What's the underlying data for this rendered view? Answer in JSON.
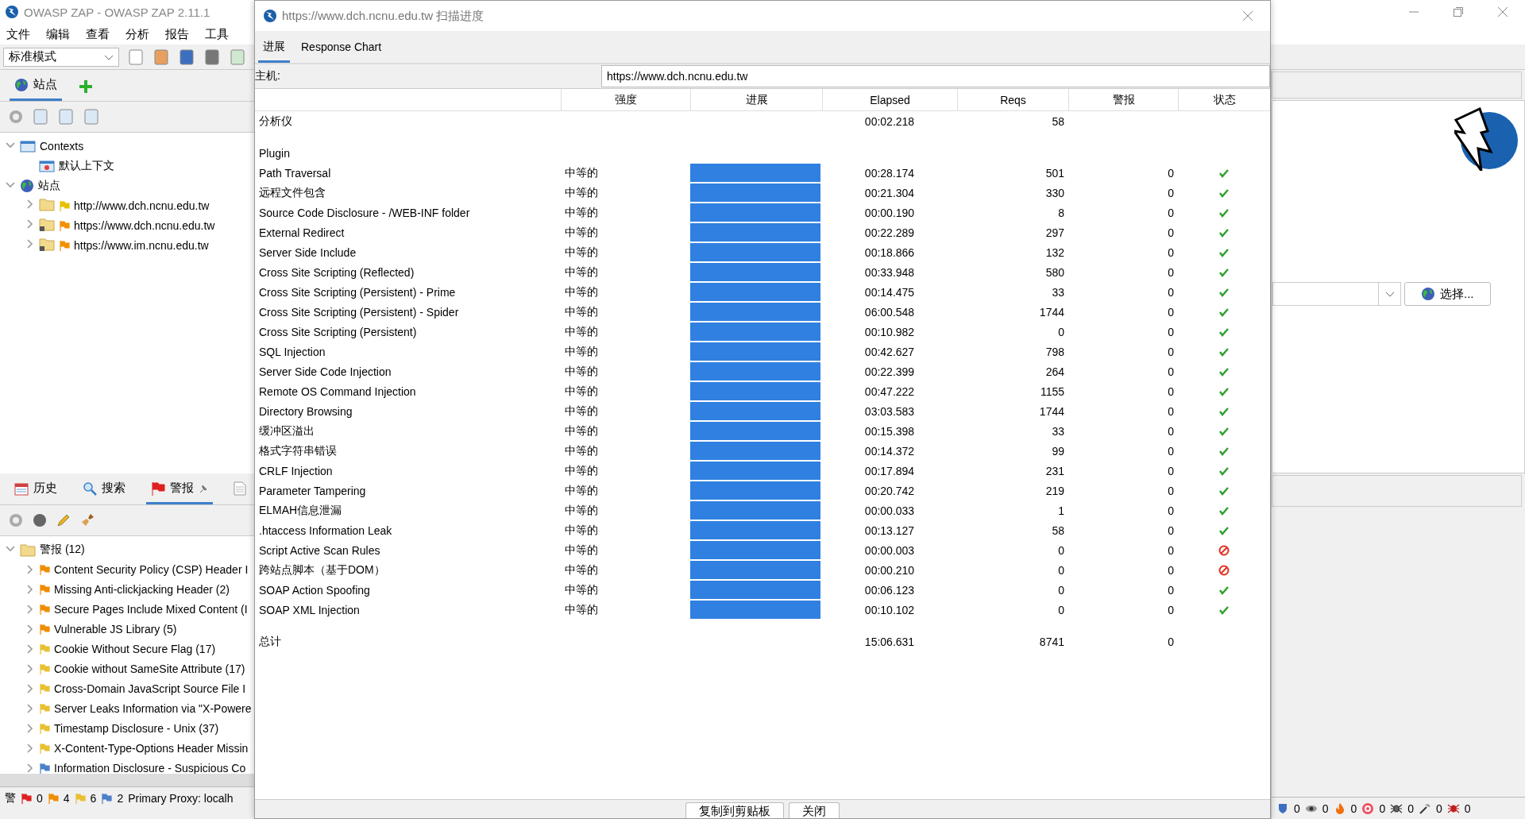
{
  "main_window": {
    "title": "OWASP ZAP - OWASP ZAP 2.11.1",
    "menu": [
      "文件",
      "编辑",
      "查看",
      "分析",
      "报告",
      "工具"
    ],
    "mode_select": {
      "value": "标准模式"
    },
    "sites_tab": {
      "label": "站点",
      "selected": true
    },
    "tree": [
      {
        "label": "Contexts",
        "kind": "contexts",
        "expanded": true,
        "children": [
          {
            "label": "默认上下文",
            "kind": "context"
          }
        ]
      },
      {
        "label": "站点",
        "kind": "sites",
        "expanded": true,
        "children": [
          {
            "label": "http://www.dch.ncnu.edu.tw",
            "kind": "site",
            "expanded": false,
            "color": "#e8c000",
            "locked": false
          },
          {
            "label": "https://www.dch.ncnu.edu.tw",
            "kind": "site",
            "expanded": false,
            "color": "#f09000",
            "locked": true
          },
          {
            "label": "https://www.im.ncnu.edu.tw",
            "kind": "site",
            "expanded": false,
            "color": "#f09000",
            "locked": true
          }
        ]
      }
    ],
    "bottom_tabs": [
      {
        "label": "历史",
        "kind": "history",
        "selected": false
      },
      {
        "label": "搜索",
        "kind": "search",
        "selected": false
      },
      {
        "label": "警报",
        "kind": "alerts",
        "selected": true
      },
      {
        "kind": "output",
        "selected": false
      }
    ],
    "alert_root": {
      "label": "警报 (12)",
      "expanded": true
    },
    "alerts": [
      {
        "label": "Content Security Policy (CSP) Header I",
        "color": "#f08c00"
      },
      {
        "label": "Missing Anti-clickjacking Header (2)",
        "color": "#f08c00"
      },
      {
        "label": "Secure Pages Include Mixed Content (I",
        "color": "#f08c00"
      },
      {
        "label": "Vulnerable JS Library (5)",
        "color": "#f08c00"
      },
      {
        "label": "Cookie Without Secure Flag (17)",
        "color": "#e8c030"
      },
      {
        "label": "Cookie without SameSite Attribute (17)",
        "color": "#e8c030"
      },
      {
        "label": "Cross-Domain JavaScript Source File I",
        "color": "#e8c030"
      },
      {
        "label": "Server Leaks Information via \"X-Powere",
        "color": "#e8c030"
      },
      {
        "label": "Timestamp Disclosure - Unix (37)",
        "color": "#e8c030"
      },
      {
        "label": "X-Content-Type-Options Header Missin",
        "color": "#e8c030"
      },
      {
        "label": "Information Disclosure - Suspicious Co",
        "color": "#4a80c8"
      }
    ],
    "status_bar": {
      "label": "警",
      "counts": [
        {
          "value": "0",
          "color": "#e02020"
        },
        {
          "value": "4",
          "color": "#f08c00"
        },
        {
          "value": "6",
          "color": "#e8c030"
        },
        {
          "value": "2",
          "color": "#4a80c8"
        }
      ],
      "proxy": "Primary Proxy: localh"
    },
    "url_select": {
      "button": "选择..."
    },
    "scan_counts": [
      {
        "kind": "shield",
        "value": "0"
      },
      {
        "kind": "eye",
        "value": "0"
      },
      {
        "kind": "flame",
        "value": "0"
      },
      {
        "kind": "target",
        "value": "0"
      },
      {
        "kind": "spider",
        "value": "0"
      },
      {
        "kind": "hammer",
        "value": "0"
      },
      {
        "kind": "bug",
        "value": "0"
      }
    ]
  },
  "dialog": {
    "title": "https://www.dch.ncnu.edu.tw 扫描进度",
    "tabs": [
      {
        "label": "进展",
        "selected": true
      },
      {
        "label": "Response Chart",
        "selected": false
      }
    ],
    "host_label": "主机:",
    "host_value": "https://www.dch.ncnu.edu.tw",
    "columns": [
      "强度",
      "进展",
      "Elapsed",
      "Reqs",
      "警报",
      "状态"
    ],
    "analyser": {
      "name": "分析仪",
      "elapsed": "00:02.218",
      "reqs": "58"
    },
    "section": "Plugin",
    "plugins": [
      {
        "name": "Path Traversal",
        "strength": "中等的",
        "level": 1,
        "elapsed": "00:28.174",
        "reqs": "501",
        "alerts": "0",
        "kind": "check"
      },
      {
        "name": "远程文件包含",
        "strength": "中等的",
        "level": 1,
        "elapsed": "00:21.304",
        "reqs": "330",
        "alerts": "0",
        "kind": "check"
      },
      {
        "name": "Source Code Disclosure - /WEB-INF folder",
        "strength": "中等的",
        "level": 1,
        "elapsed": "00:00.190",
        "reqs": "8",
        "alerts": "0",
        "kind": "check"
      },
      {
        "name": "External Redirect",
        "strength": "中等的",
        "level": 1,
        "elapsed": "00:22.289",
        "reqs": "297",
        "alerts": "0",
        "kind": "check"
      },
      {
        "name": "Server Side Include",
        "strength": "中等的",
        "level": 1,
        "elapsed": "00:18.866",
        "reqs": "132",
        "alerts": "0",
        "kind": "check"
      },
      {
        "name": "Cross Site Scripting (Reflected)",
        "strength": "中等的",
        "level": 1,
        "elapsed": "00:33.948",
        "reqs": "580",
        "alerts": "0",
        "kind": "check"
      },
      {
        "name": "Cross Site Scripting (Persistent) - Prime",
        "strength": "中等的",
        "level": 1,
        "elapsed": "00:14.475",
        "reqs": "33",
        "alerts": "0",
        "kind": "check"
      },
      {
        "name": "Cross Site Scripting (Persistent) - Spider",
        "strength": "中等的",
        "level": 1,
        "elapsed": "06:00.548",
        "reqs": "1744",
        "alerts": "0",
        "kind": "check"
      },
      {
        "name": "Cross Site Scripting (Persistent)",
        "strength": "中等的",
        "level": 1,
        "elapsed": "00:10.982",
        "reqs": "0",
        "alerts": "0",
        "kind": "check"
      },
      {
        "name": "SQL Injection",
        "strength": "中等的",
        "level": 1,
        "elapsed": "00:42.627",
        "reqs": "798",
        "alerts": "0",
        "kind": "check"
      },
      {
        "name": "Server Side Code Injection",
        "strength": "中等的",
        "level": 1,
        "elapsed": "00:22.399",
        "reqs": "264",
        "alerts": "0",
        "kind": "check"
      },
      {
        "name": "Remote OS Command Injection",
        "strength": "中等的",
        "level": 1,
        "elapsed": "00:47.222",
        "reqs": "1155",
        "alerts": "0",
        "kind": "check"
      },
      {
        "name": "Directory Browsing",
        "strength": "中等的",
        "level": 1,
        "elapsed": "03:03.583",
        "reqs": "1744",
        "alerts": "0",
        "kind": "check"
      },
      {
        "name": "缓冲区溢出",
        "strength": "中等的",
        "level": 1,
        "elapsed": "00:15.398",
        "reqs": "33",
        "alerts": "0",
        "kind": "check"
      },
      {
        "name": "格式字符串错误",
        "strength": "中等的",
        "level": 1,
        "elapsed": "00:14.372",
        "reqs": "99",
        "alerts": "0",
        "kind": "check"
      },
      {
        "name": "CRLF Injection",
        "strength": "中等的",
        "level": 1,
        "elapsed": "00:17.894",
        "reqs": "231",
        "alerts": "0",
        "kind": "check"
      },
      {
        "name": "Parameter Tampering",
        "strength": "中等的",
        "level": 1,
        "elapsed": "00:20.742",
        "reqs": "219",
        "alerts": "0",
        "kind": "check"
      },
      {
        "name": "ELMAH信息泄漏",
        "strength": "中等的",
        "level": 1,
        "elapsed": "00:00.033",
        "reqs": "1",
        "alerts": "0",
        "kind": "check"
      },
      {
        "name": ".htaccess Information Leak",
        "strength": "中等的",
        "level": 1,
        "elapsed": "00:13.127",
        "reqs": "58",
        "alerts": "0",
        "kind": "check"
      },
      {
        "name": "Script Active Scan Rules",
        "strength": "中等的",
        "level": 1,
        "elapsed": "00:00.003",
        "reqs": "0",
        "alerts": "0",
        "kind": "blocked"
      },
      {
        "name": "跨站点脚本（基于DOM）",
        "strength": "中等的",
        "level": 1,
        "elapsed": "00:00.210",
        "reqs": "0",
        "alerts": "0",
        "kind": "blocked"
      },
      {
        "name": "SOAP Action Spoofing",
        "strength": "中等的",
        "level": 1,
        "elapsed": "00:06.123",
        "reqs": "0",
        "alerts": "0",
        "kind": "check"
      },
      {
        "name": "SOAP XML Injection",
        "strength": "中等的",
        "level": 1,
        "elapsed": "00:10.102",
        "reqs": "0",
        "alerts": "0",
        "kind": "check"
      }
    ],
    "total": {
      "name": "总计",
      "elapsed": "15:06.631",
      "reqs": "8741",
      "alerts": "0"
    },
    "buttons": [
      "复制到剪贴板",
      "关闭"
    ]
  }
}
